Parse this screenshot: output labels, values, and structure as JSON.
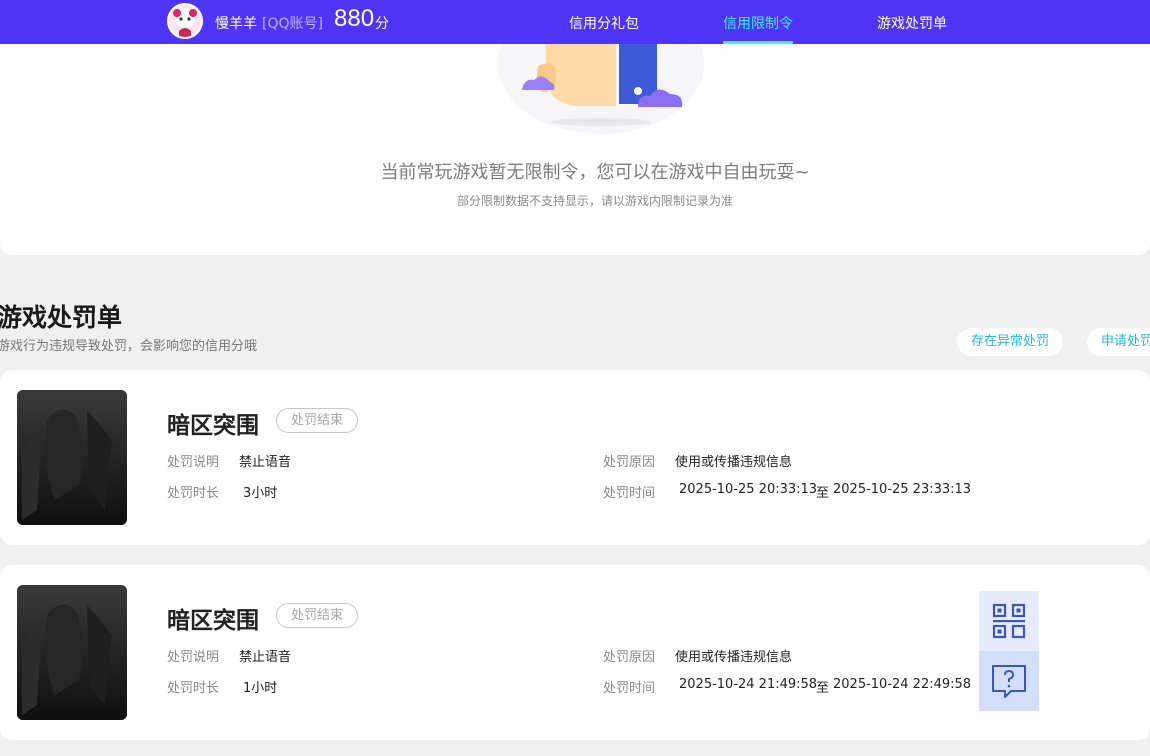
{
  "header": {
    "username": "慢羊羊",
    "account_type": "[QQ账号]",
    "score": "880",
    "score_unit": "分",
    "nav": [
      {
        "label": "信用分礼包",
        "active": false
      },
      {
        "label": "信用限制令",
        "active": true
      },
      {
        "label": "游戏处罚单",
        "active": false
      }
    ],
    "brand_color": "#4e35f5",
    "active_color": "#3ff0f8"
  },
  "restriction": {
    "message": "当前常玩游戏暂无限制令，您可以在游戏中自由玩耍~",
    "note": "部分限制数据不支持显示，请以游戏内限制记录为准"
  },
  "penalties": {
    "title": "游戏处罚单",
    "subtitle": "游戏行为违规导致处罚，会影响您的信用分哦",
    "actions": [
      "存在异常处罚",
      "申请处罚"
    ],
    "labels": {
      "description": "处罚说明",
      "duration": "处罚时长",
      "reason": "处罚原因",
      "time": "处罚时间",
      "to": "至"
    },
    "items": [
      {
        "game": "暗区突围",
        "status": "处罚结束",
        "description": "禁止语音",
        "duration": "3小时",
        "reason": "使用或传播违规信息",
        "start": "2025-10-25 20:33:13",
        "end": "2025-10-25 23:33:13"
      },
      {
        "game": "暗区突围",
        "status": "处罚结束",
        "description": "禁止语音",
        "duration": "1小时",
        "reason": "使用或传播违规信息",
        "start": "2025-10-24 21:49:58",
        "end": "2025-10-24 22:49:58"
      }
    ]
  },
  "side_tools": {
    "qr_icon": "qr-code-icon",
    "help_icon": "help-chat-icon"
  }
}
